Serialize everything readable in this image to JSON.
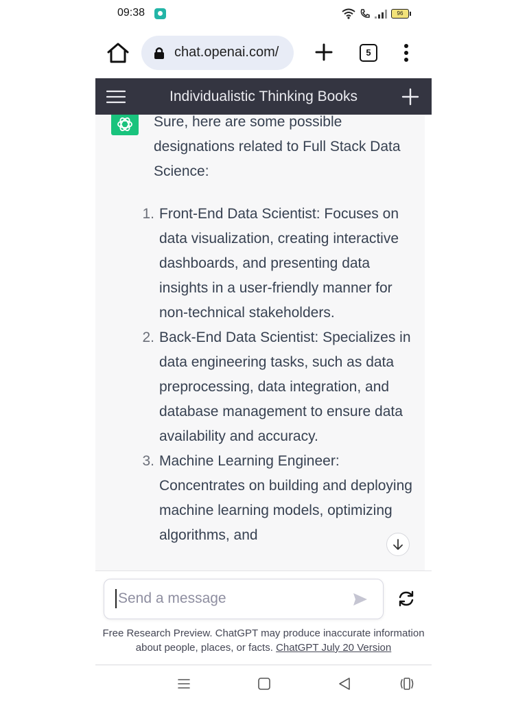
{
  "status_bar": {
    "time": "09:38",
    "battery": "96"
  },
  "browser": {
    "url": "chat.openai.com/",
    "tab_count": "5"
  },
  "chat": {
    "title": "Individualistic Thinking Books",
    "intro": "Sure, here are some possible designations related to Full Stack Data Science:",
    "items": [
      {
        "num": "1.",
        "text": "Front-End Data Scientist: Focuses on data visualization, creating interactive dashboards, and presenting data insights in a user-friendly manner for non-technical stakeholders."
      },
      {
        "num": "2.",
        "text": "Back-End Data Scientist: Specializes in data engineering tasks, such as data preprocessing, data integration, and database management to ensure data availability and accuracy."
      },
      {
        "num": "3.",
        "text": "Machine Learning Engineer: Concentrates on building and deploying machine learning models, optimizing algorithms, and"
      }
    ]
  },
  "composer": {
    "placeholder": "Send a message"
  },
  "footer": {
    "note": "Free Research Preview. ChatGPT may produce inaccurate information about people, places, or facts.",
    "link": "ChatGPT July 20 Version"
  },
  "colors": {
    "header_bg": "#343541",
    "chat_bg": "#f7f7f8",
    "avatar_green": "#19c37d",
    "url_pill": "#e8ecf6"
  },
  "icons": [
    "home-icon",
    "lock-icon",
    "plus-icon",
    "tabs-icon",
    "kebab-menu-icon",
    "hamburger-icon",
    "openai-logo-icon",
    "arrow-down-icon",
    "send-icon",
    "refresh-icon",
    "recents-icon",
    "home-square-icon",
    "back-triangle-icon",
    "assistant-icon"
  ]
}
